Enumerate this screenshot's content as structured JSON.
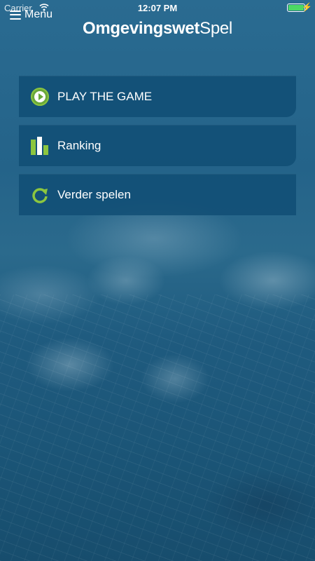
{
  "status_bar": {
    "carrier": "Carrier",
    "time": "12:07 PM",
    "battery_level": 1.0,
    "icons": [
      "wifi-icon",
      "battery-icon",
      "charging-icon"
    ]
  },
  "header": {
    "menu_label": "Menu",
    "title_bold": "Omgevingswet",
    "title_light": "Spel"
  },
  "menu": {
    "items": [
      {
        "label": "PLAY THE GAME",
        "icon": "play-icon"
      },
      {
        "label": "Ranking",
        "icon": "ranking-icon"
      },
      {
        "label": "Verder spelen",
        "icon": "refresh-icon"
      }
    ]
  },
  "colors": {
    "accent_green": "#8cc63f",
    "button_bg": "#104e74",
    "background": "#1d5a7e"
  }
}
